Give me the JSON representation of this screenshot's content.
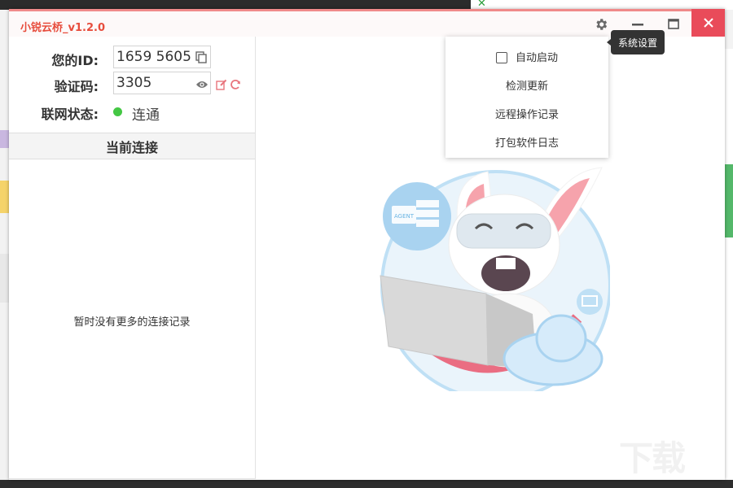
{
  "window": {
    "title": "小锐云桥_v1.2.0",
    "accent_color": "#e74c3c",
    "close_color": "#e94b5a"
  },
  "titlebar_controls": {
    "settings_icon": "gear-icon",
    "minimize_icon": "minimize-icon",
    "maximize_icon": "maximize-icon",
    "close_icon": "close-icon"
  },
  "tooltip": {
    "text": "系统设置"
  },
  "connection_info": {
    "id_label": "您的ID:",
    "id_value": "1659 5605",
    "code_label": "验证码:",
    "code_value": "3305",
    "status_label": "联网状态:",
    "status_value": "连通",
    "status_color": "#44c744"
  },
  "current_connection": {
    "header": "当前连接",
    "empty_message": "暂时没有更多的连接记录"
  },
  "settings_menu": {
    "items": [
      {
        "label": "自动启动",
        "type": "checkbox",
        "checked": false
      },
      {
        "label": "检测更新",
        "type": "action"
      },
      {
        "label": "远程操作记录",
        "type": "action"
      },
      {
        "label": "打包软件日志",
        "type": "action"
      }
    ]
  },
  "illustration": {
    "agent_label": "AGENT"
  }
}
